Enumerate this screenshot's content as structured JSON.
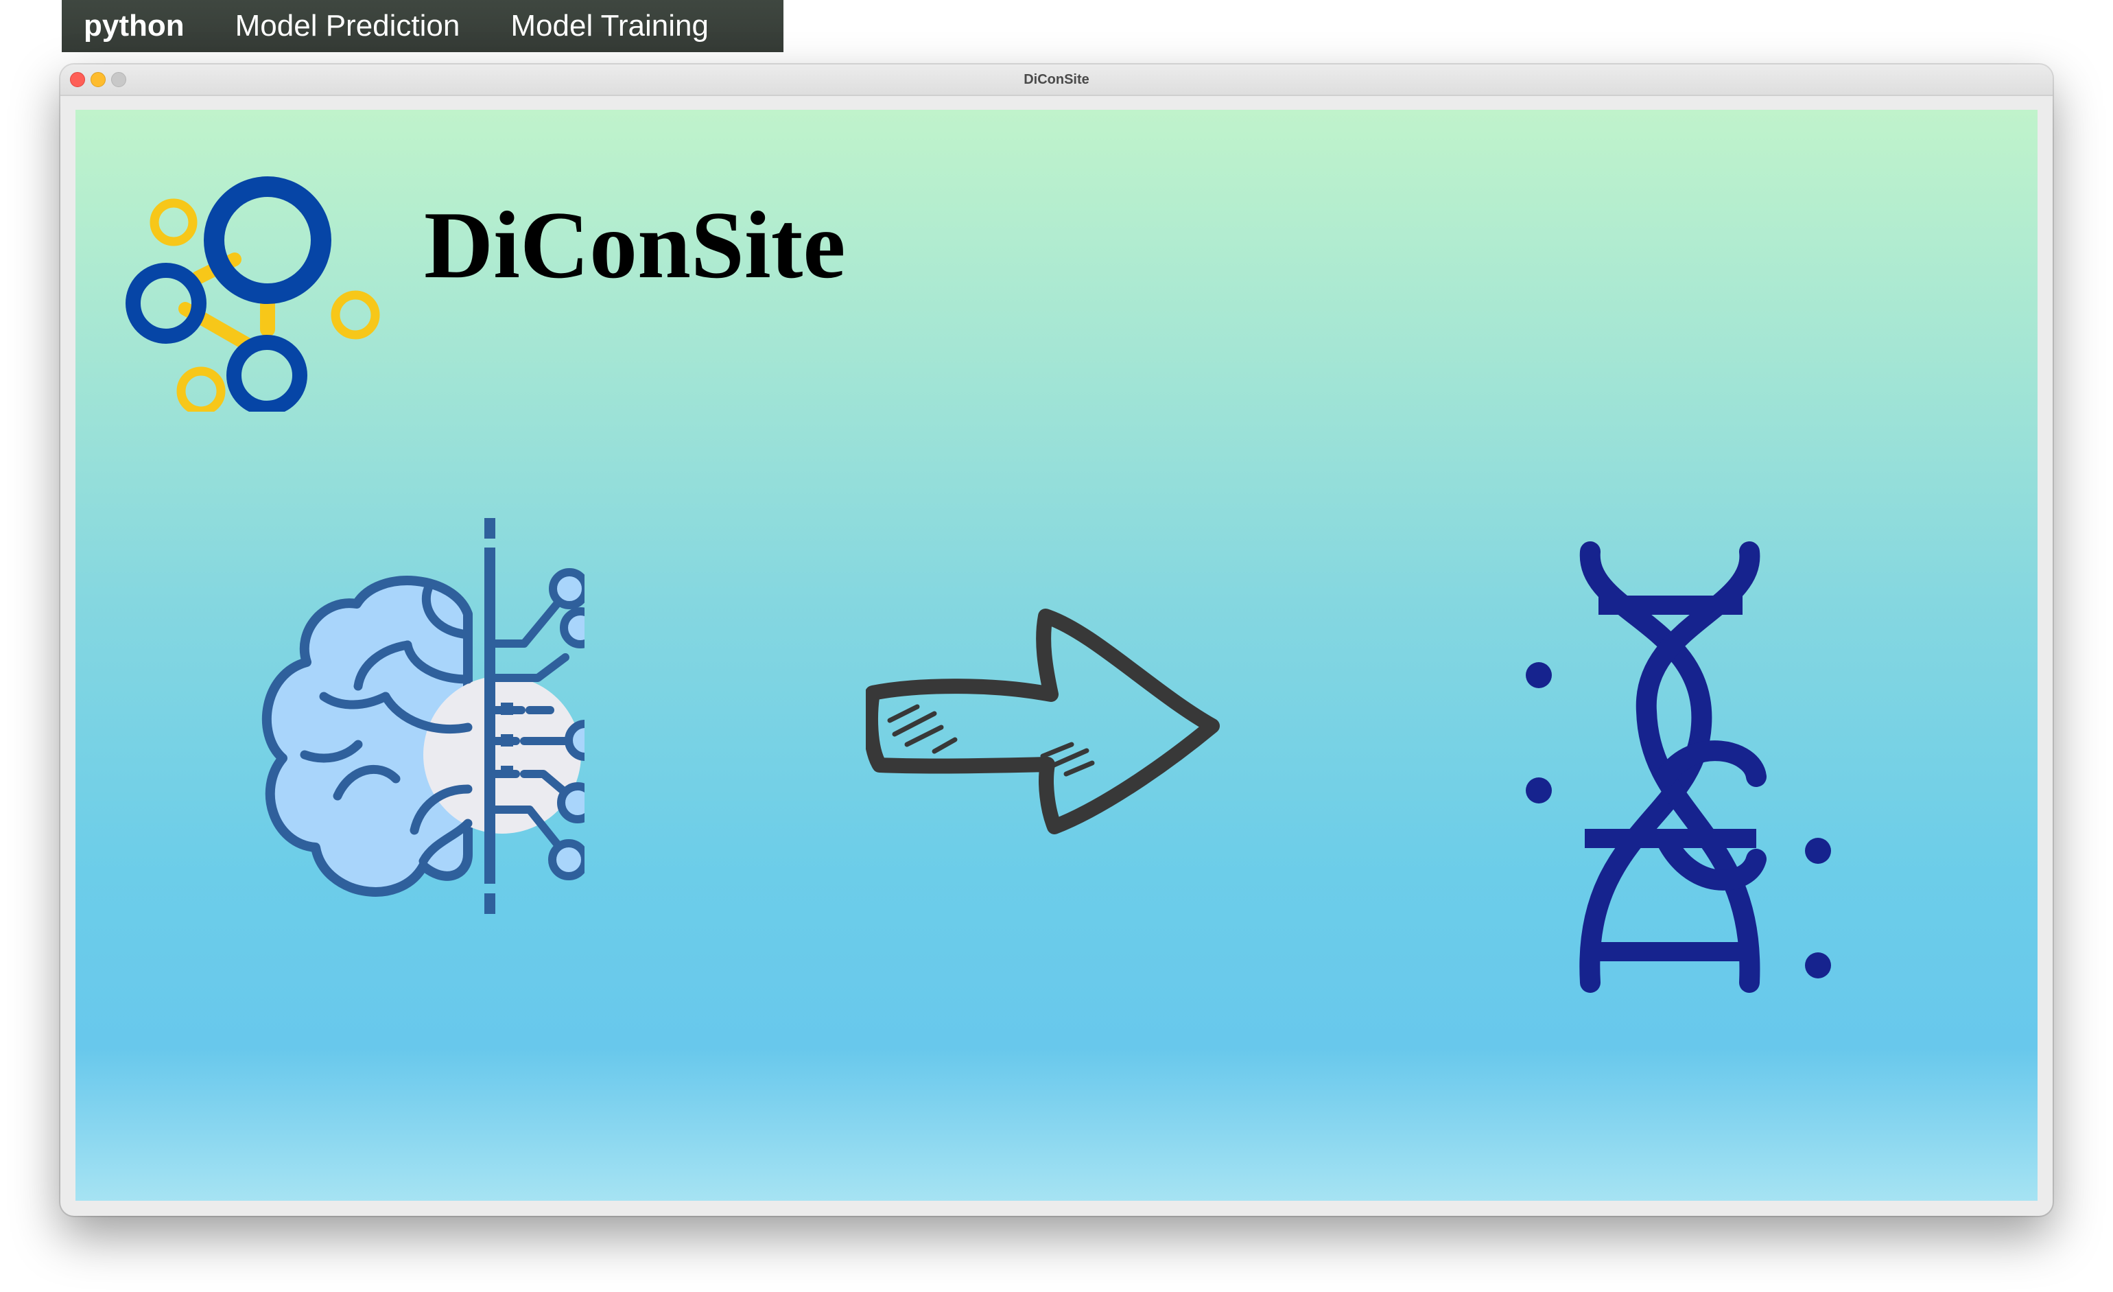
{
  "menubar": {
    "app_name": "python",
    "items": [
      {
        "label": "Model Prediction"
      },
      {
        "label": "Model Training"
      }
    ]
  },
  "window": {
    "title": "DiConSite"
  },
  "main": {
    "brand_title": "DiConSite",
    "icons": {
      "logo": "molecule-network-logo",
      "left": "ai-brain-circuit-icon",
      "center": "right-arrow-icon",
      "right": "dna-helix-icon"
    }
  },
  "colors": {
    "background_top": "#c0f3cb",
    "background_bottom": "#68c8ec",
    "logo_blue": "#0645a6",
    "logo_yellow": "#f7c719",
    "brain_outline": "#2f609c",
    "brain_fill": "#a9d5fb",
    "arrow_stroke": "#383838",
    "dna_blue": "#16238e"
  }
}
